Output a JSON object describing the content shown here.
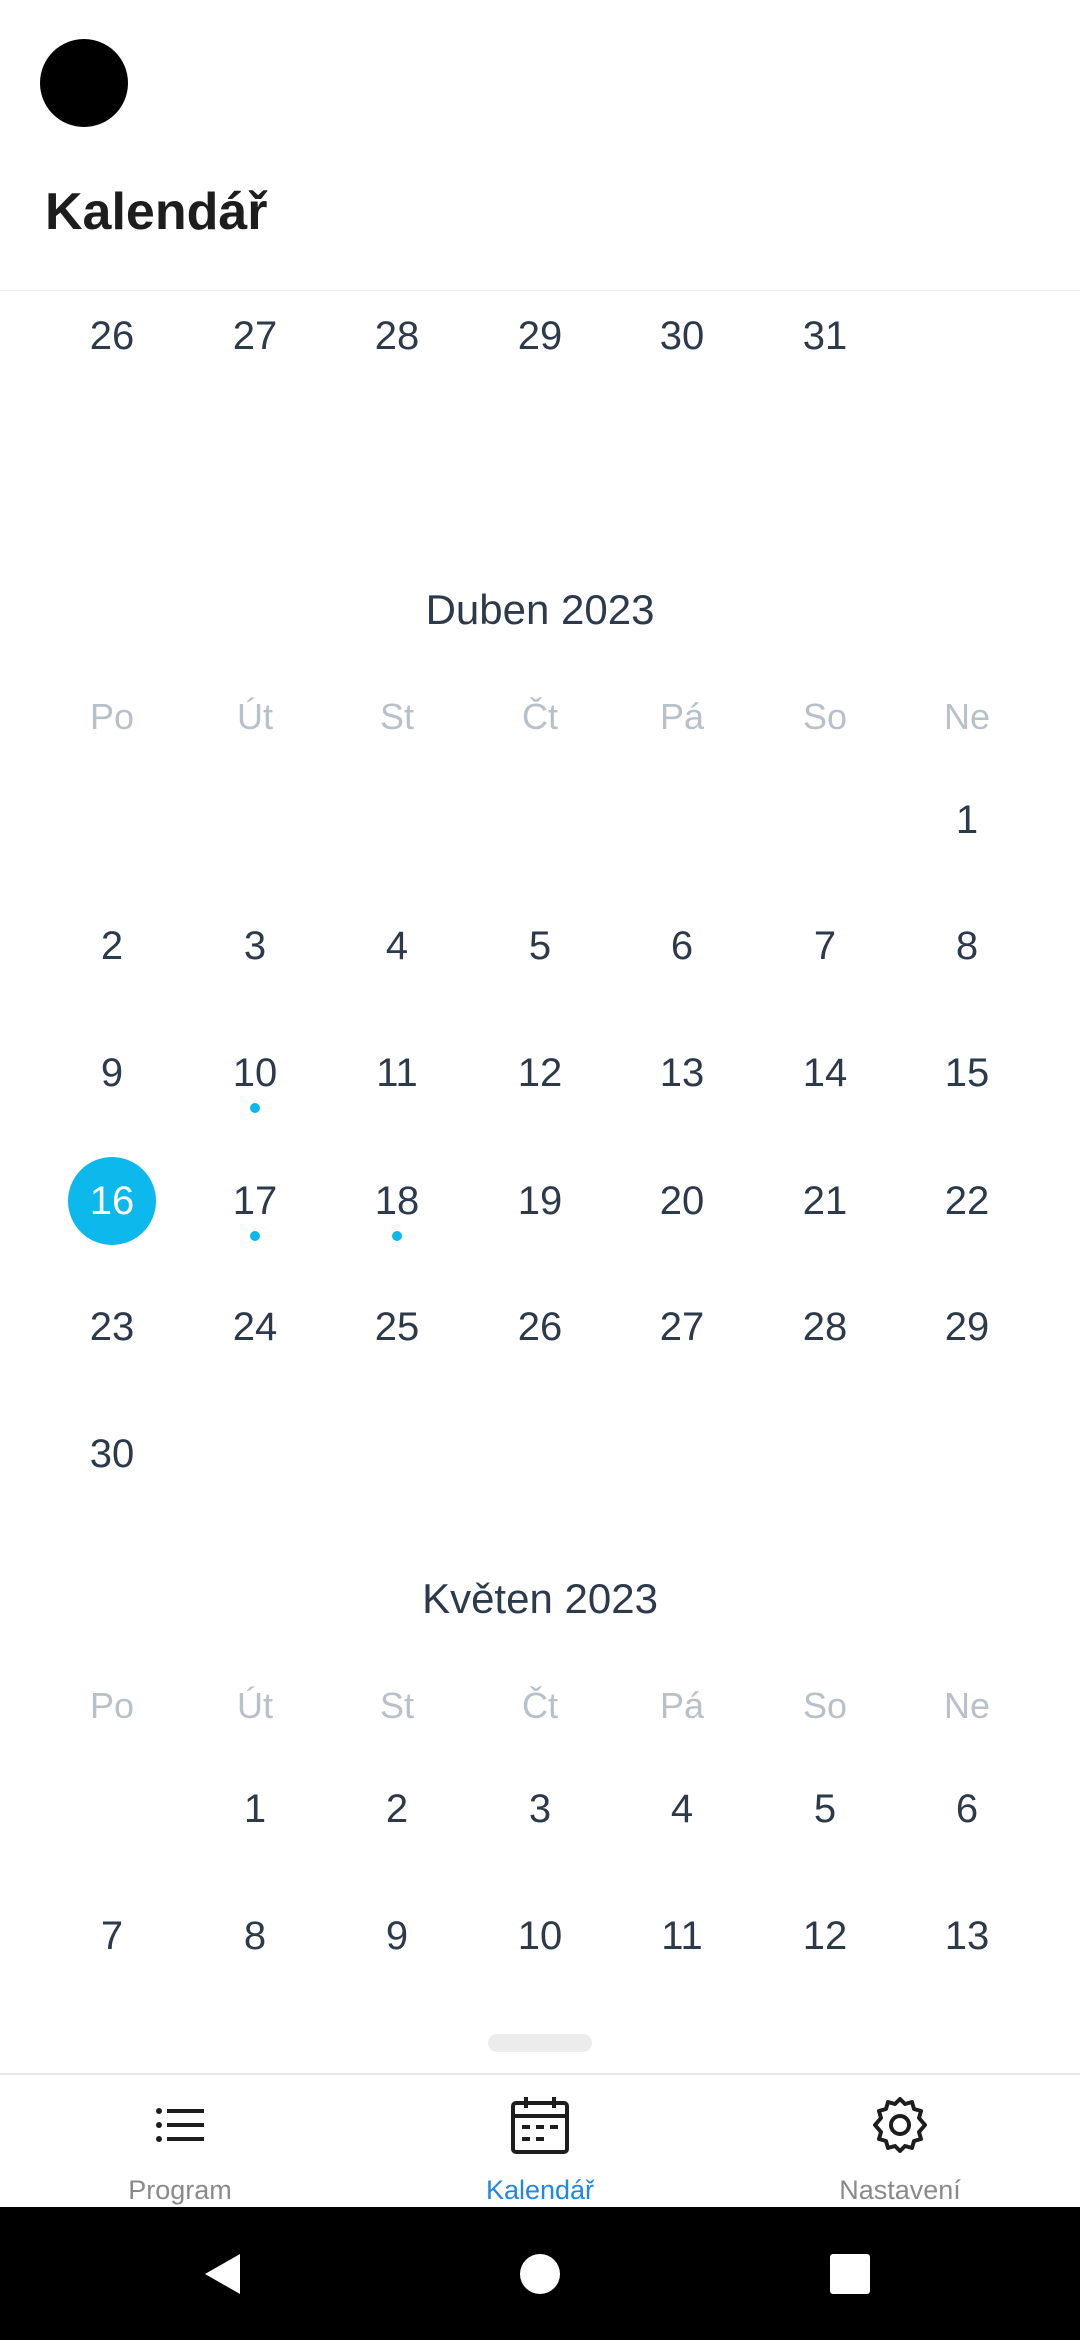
{
  "header": {
    "title": "Kalendář"
  },
  "calendar": {
    "weekdays": [
      "Po",
      "Út",
      "St",
      "Čt",
      "Pá",
      "So",
      "Ne"
    ],
    "prev_tail": [
      "26",
      "27",
      "28",
      "29",
      "30",
      "31"
    ],
    "april": {
      "title": "Duben 2023",
      "weeks": [
        [
          "",
          "",
          "",
          "",
          "",
          "",
          "1"
        ],
        [
          "2",
          "3",
          "4",
          "5",
          "6",
          "7",
          "8"
        ],
        [
          "9",
          "10",
          "11",
          "12",
          "13",
          "14",
          "15"
        ],
        [
          "16",
          "17",
          "18",
          "19",
          "20",
          "21",
          "22"
        ],
        [
          "23",
          "24",
          "25",
          "26",
          "27",
          "28",
          "29"
        ],
        [
          "30",
          "",
          "",
          "",
          "",
          "",
          ""
        ]
      ],
      "selected_day": "16",
      "days_with_events": [
        "10",
        "17",
        "18"
      ]
    },
    "may": {
      "title": "Květen 2023",
      "weeks": [
        [
          "",
          "1",
          "2",
          "3",
          "4",
          "5",
          "6"
        ],
        [
          "7",
          "8",
          "9",
          "10",
          "11",
          "12",
          "13"
        ]
      ]
    }
  },
  "bottom_nav": {
    "items": [
      {
        "label": "Program",
        "icon": "list-icon",
        "active": false
      },
      {
        "label": "Kalendář",
        "icon": "calendar-icon",
        "active": true
      },
      {
        "label": "Nastavení",
        "icon": "gear-icon",
        "active": false
      }
    ]
  },
  "colors": {
    "accent": "#0db8ec",
    "active_nav": "#1f87e6",
    "text": "#2c3a4b",
    "weekday": "#b8c0ca"
  }
}
